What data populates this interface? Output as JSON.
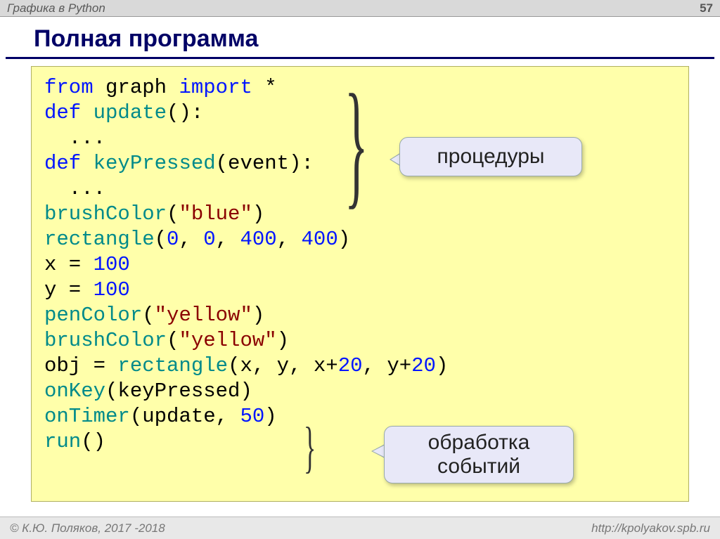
{
  "header": {
    "topic": "Графика в Python",
    "slide_no": "57"
  },
  "title": "Полная программа",
  "code": {
    "l1_kw1": "from",
    "l1_mod": "graph",
    "l1_kw2": "import",
    "l1_star": " *",
    "l2_kw": "def",
    "l2_fn": "update",
    "l2_rest": "():",
    "l3": "  ...",
    "l4_kw": "def",
    "l4_fn": "keyPressed",
    "l4_rest": "(event):",
    "l5": "  ...",
    "l6_fn": "brushColor",
    "l6_p": "(",
    "l6_str": "\"blue\"",
    "l6_q": ")",
    "l7_fn": "rectangle",
    "l7_p": "(",
    "l7_n1": "0",
    "l7_c1": ", ",
    "l7_n2": "0",
    "l7_c2": ", ",
    "l7_n3": "400",
    "l7_c3": ", ",
    "l7_n4": "400",
    "l7_q": ")",
    "l8_a": "x = ",
    "l8_n": "100",
    "l9_a": "y = ",
    "l9_n": "100",
    "l10_fn": "penColor",
    "l10_p": "(",
    "l10_str": "\"yellow\"",
    "l10_q": ")",
    "l11_fn": "brushColor",
    "l11_p": "(",
    "l11_str": "\"yellow\"",
    "l11_q": ")",
    "l12_a": "obj = ",
    "l12_fn": "rectangle",
    "l12_rest1": "(x, y, x+",
    "l12_n1": "20",
    "l12_rest2": ", y+",
    "l12_n2": "20",
    "l12_q": ")",
    "l13_fn": "onKey",
    "l13_rest": "(keyPressed)",
    "l14_fn": "onTimer",
    "l14_p": "(update, ",
    "l14_n": "50",
    "l14_q": ")",
    "l15_fn": "run",
    "l15_rest": "()"
  },
  "callouts": {
    "procedures": "процедуры",
    "events_l1": "обработка",
    "events_l2": "событий"
  },
  "footer": {
    "copyright": "© К.Ю. Поляков, 2017 -2018",
    "url": "http://kpolyakov.spb.ru"
  }
}
